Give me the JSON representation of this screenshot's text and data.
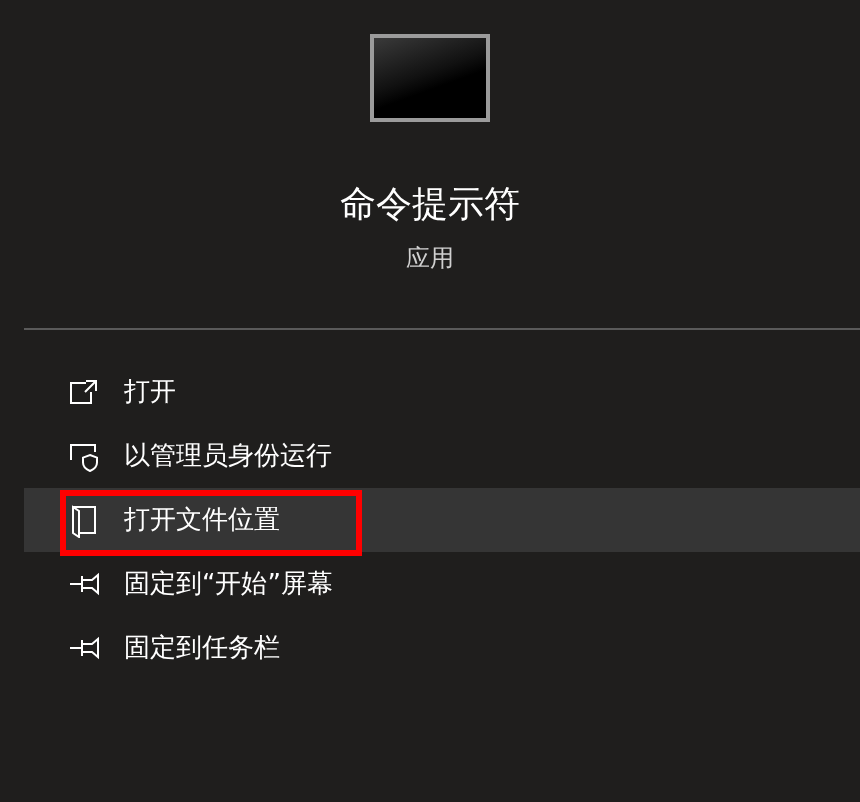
{
  "app": {
    "name": "命令提示符",
    "type": "应用"
  },
  "actions": [
    {
      "label": "打开",
      "kind": "open",
      "selected": false,
      "annotated": false
    },
    {
      "label": "以管理员身份运行",
      "kind": "shield",
      "selected": false,
      "annotated": false
    },
    {
      "label": "打开文件位置",
      "kind": "folder",
      "selected": true,
      "annotated": true
    },
    {
      "label": "固定到“开始”屏幕",
      "kind": "pin",
      "selected": false,
      "annotated": false
    },
    {
      "label": "固定到任务栏",
      "kind": "pin",
      "selected": false,
      "annotated": false
    }
  ]
}
